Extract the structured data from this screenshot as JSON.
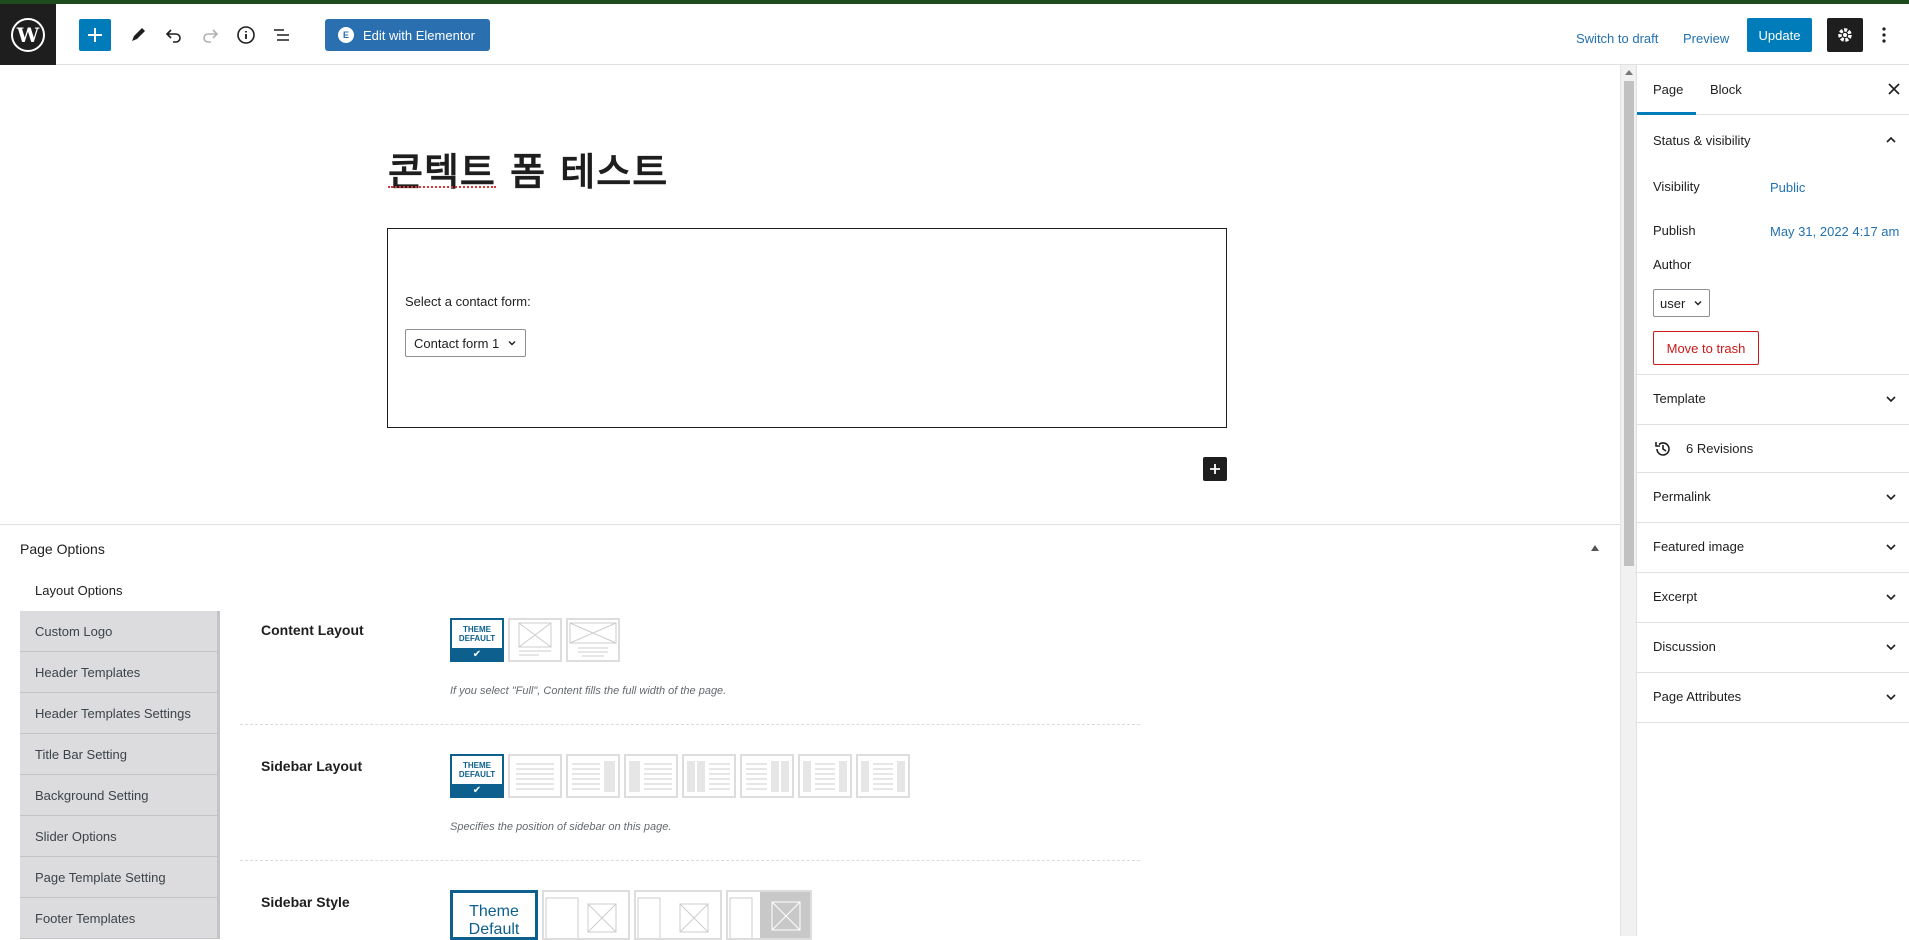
{
  "toolbar": {
    "elementor_label": "Edit with Elementor",
    "switch_to_draft": "Switch to draft",
    "preview": "Preview",
    "update": "Update"
  },
  "editor": {
    "title": "콘텍트 폼 테스트",
    "contact_form": {
      "label": "Select a contact form:",
      "selected": "Contact form 1"
    }
  },
  "page_options": {
    "title": "Page Options",
    "nav": [
      "Layout Options",
      "Custom Logo",
      "Header Templates",
      "Header Templates Settings",
      "Title Bar Setting",
      "Background Setting",
      "Slider Options",
      "Page Template Setting",
      "Footer Templates"
    ],
    "content_layout": {
      "label": "Content Layout",
      "theme_default": "THEME DEFAULT",
      "description": "If you select \"Full\", Content fills the full width of the page."
    },
    "sidebar_layout": {
      "label": "Sidebar Layout",
      "theme_default": "THEME DEFAULT",
      "description": "Specifies the position of sidebar on this page."
    },
    "sidebar_style": {
      "label": "Sidebar Style",
      "theme_default": "Theme Default"
    }
  },
  "sidebar": {
    "tabs": [
      "Page",
      "Block"
    ],
    "status": {
      "title": "Status & visibility",
      "visibility_label": "Visibility",
      "visibility_value": "Public",
      "publish_label": "Publish",
      "publish_value": "May 31, 2022 4:17 am",
      "author_label": "Author",
      "author_value": "user",
      "trash": "Move to trash"
    },
    "template": "Template",
    "revisions": "6 Revisions",
    "permalink": "Permalink",
    "featured_image": "Featured image",
    "excerpt": "Excerpt",
    "discussion": "Discussion",
    "page_attributes": "Page Attributes"
  },
  "colors": {
    "accent": "#007cba",
    "elementor": "#2a6fb0",
    "danger": "#cc1818"
  }
}
